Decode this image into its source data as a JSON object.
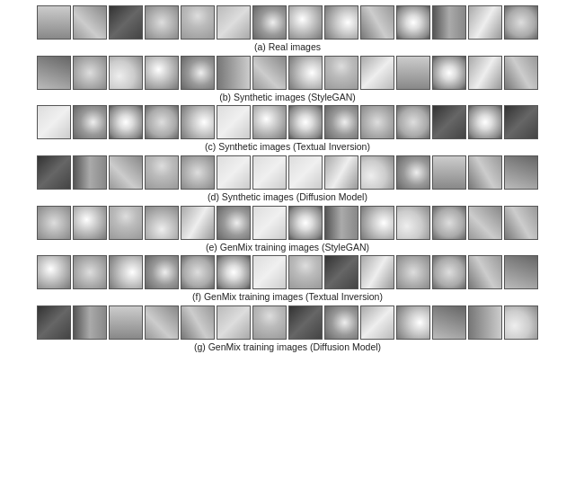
{
  "sections": [
    {
      "id": "a",
      "caption": "(a) Real images",
      "rows": 1,
      "cells_per_row": 14
    },
    {
      "id": "b",
      "caption": "(b) Synthetic images (StyleGAN)",
      "rows": 1,
      "cells_per_row": 14
    },
    {
      "id": "c",
      "caption": "(c) Synthetic images (Textual Inversion)",
      "rows": 1,
      "cells_per_row": 14
    },
    {
      "id": "d",
      "caption": "(d) Synthetic images (Diffusion Model)",
      "rows": 1,
      "cells_per_row": 14
    },
    {
      "id": "e",
      "caption": "(e) GenMix training images (StyleGAN)",
      "rows": 1,
      "cells_per_row": 14
    },
    {
      "id": "f",
      "caption": "(f) GenMix training images (Textual Inversion)",
      "rows": 1,
      "cells_per_row": 14
    },
    {
      "id": "g",
      "caption": "(g) GenMix training images (Diffusion Model)",
      "rows": 1,
      "cells_per_row": 14
    }
  ]
}
